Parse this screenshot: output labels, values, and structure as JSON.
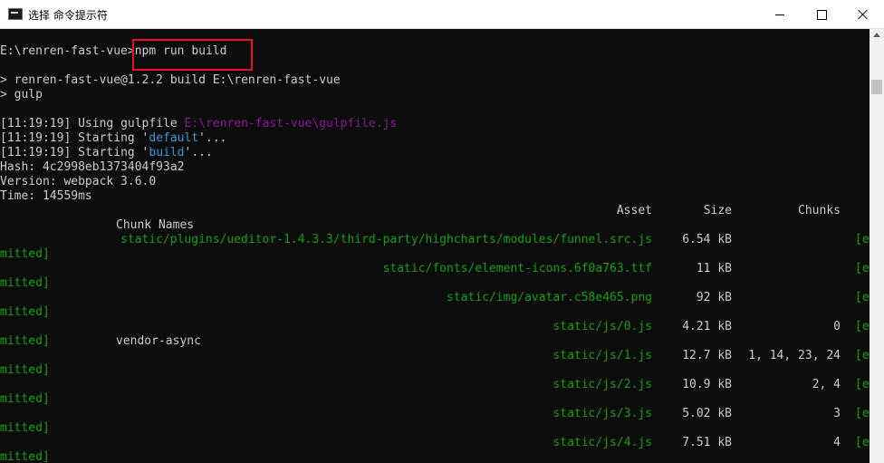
{
  "window": {
    "title": "选择 命令提示符"
  },
  "console": {
    "prompt_path": "E:\\renren-fast-vue>",
    "command": "npm run build",
    "line_renren": "> renren-fast-vue@1.2.2 build E:\\renren-fast-vue",
    "line_gulp": "> gulp",
    "log1_time": "[11:19:19]",
    "log1_text": " Using gulpfile ",
    "log1_path": "E:\\renren-fast-vue\\gulpfile.js",
    "log2_time": "[11:19:19]",
    "log2_pre": " Starting '",
    "log2_task": "default",
    "log2_post": "'...",
    "log3_time": "[11:19:19]",
    "log3_pre": " Starting '",
    "log3_task": "build",
    "log3_post": "'...",
    "hash": "Hash: 4c2998eb1373404f93a2",
    "version": "Version: webpack 3.6.0",
    "time": "Time: 14559ms",
    "header_asset": "Asset",
    "header_size": "Size",
    "header_chunks": "Chunks",
    "header_chunk_names": "Chunk Names",
    "rows": [
      {
        "asset": "static/plugins/ueditor-1.4.3.3/third-party/highcharts/modules/funnel.src.js",
        "size": "6.54 kB",
        "chunks": "",
        "status": "[e",
        "status_tail": "mitted]",
        "name": ""
      },
      {
        "asset": "static/fonts/element-icons.6f0a763.ttf",
        "size": "11 kB",
        "chunks": "",
        "status": "[e",
        "status_tail": "mitted]",
        "name": ""
      },
      {
        "asset": "static/img/avatar.c58e465.png",
        "size": "92 kB",
        "chunks": "",
        "status": "[e",
        "status_tail": "mitted]",
        "name": ""
      },
      {
        "asset": "static/js/0.js",
        "size": "4.21 kB",
        "chunks": "0",
        "status": "[e",
        "status_tail": "mitted]",
        "name": "vendor-async"
      },
      {
        "asset": "static/js/1.js",
        "size": "12.7 kB",
        "chunks": "1, 14, 23, 24",
        "status": "[e",
        "status_tail": "mitted]",
        "name": ""
      },
      {
        "asset": "static/js/2.js",
        "size": "10.9 kB",
        "chunks": "2, 4",
        "status": "[e",
        "status_tail": "mitted]",
        "name": ""
      },
      {
        "asset": "static/js/3.js",
        "size": "5.02 kB",
        "chunks": "3",
        "status": "[e",
        "status_tail": "mitted]",
        "name": ""
      },
      {
        "asset": "static/js/4.js",
        "size": "7.51 kB",
        "chunks": "4",
        "status": "[e",
        "status_tail": "mitted]",
        "name": ""
      }
    ]
  },
  "colors": {
    "background": "#0c0c0c",
    "text": "#cccccc",
    "green": "#13a10e",
    "cyan": "#3a96dd",
    "magenta": "#881798",
    "highlight": "#e81123"
  },
  "icons": [
    "cmd-icon",
    "minimize-icon",
    "maximize-icon",
    "close-icon",
    "scroll-up-arrow-icon"
  ]
}
